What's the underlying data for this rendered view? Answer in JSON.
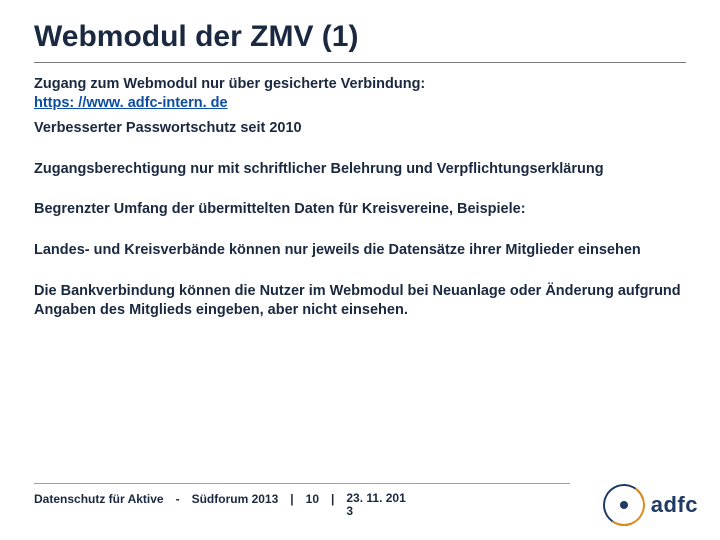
{
  "title": "Webmodul der ZMV (1)",
  "bullets": {
    "b1_line1": "Zugang zum Webmodul nur über gesicherte Verbindung:",
    "b1_link": "https: //www. adfc-intern. de",
    "b2": "Verbesserter Passwortschutz seit 2010",
    "b3": "Zugangsberechtigung nur mit schriftlicher Belehrung und Verpflichtungserklärung",
    "b4": "Begrenzter Umfang der übermittelten Daten für Kreisvereine, Beispiele:",
    "b5": "Landes- und Kreisverbände können nur jeweils die Datensätze ihrer Mitglieder einsehen",
    "b6": "Die Bankverbindung können die Nutzer im Webmodul bei Neuanlage oder Änderung aufgrund Angaben des Mitglieds eingeben, aber nicht einsehen."
  },
  "footer": {
    "left": "Datenschutz für Aktive",
    "sep1": "-",
    "event": "Südforum 2013",
    "sep2": "|",
    "page": "10",
    "sep3": "|",
    "date_top": "23. 11. 201",
    "date_bottom": "3"
  },
  "logo": {
    "text": "adfc"
  }
}
